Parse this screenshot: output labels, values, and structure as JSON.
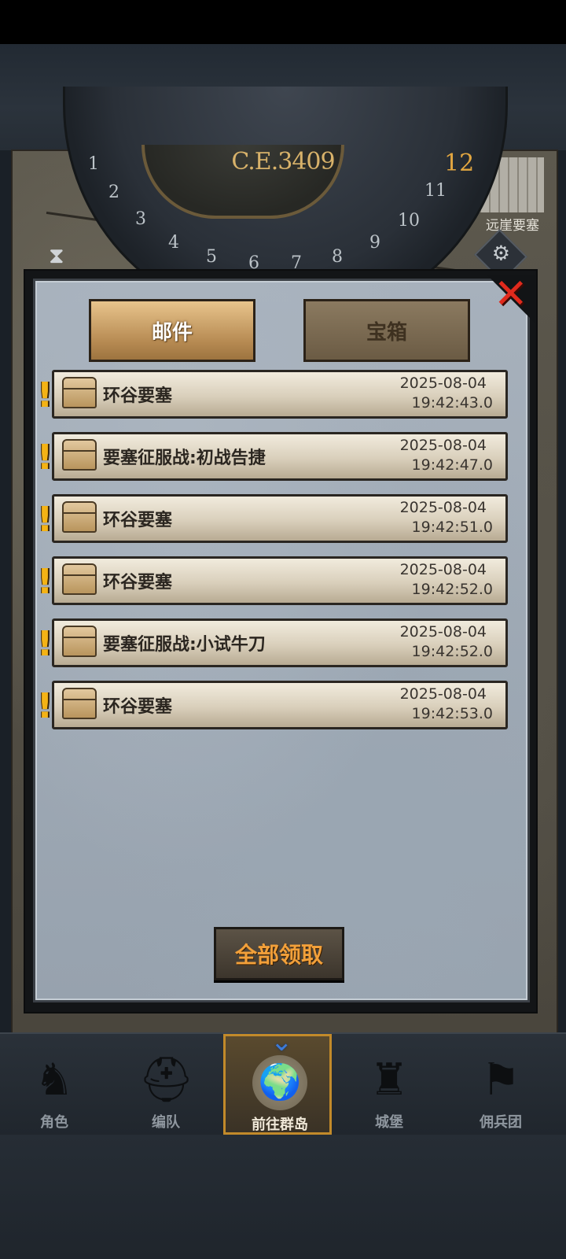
{
  "header": {
    "era": "C.E.3409",
    "hour": "12",
    "dial_numbers": [
      "1",
      "2",
      "3",
      "4",
      "5",
      "6",
      "7",
      "8",
      "9",
      "10",
      "11"
    ],
    "location": "远崖要塞"
  },
  "tabs": [
    {
      "label": "邮件",
      "active": true
    },
    {
      "label": "宝箱",
      "active": false
    }
  ],
  "mails": [
    {
      "title": "环谷要塞",
      "date": "2025-08-04",
      "time": "19:42:43.0",
      "unread": true
    },
    {
      "title": "要塞征服战:初战告捷",
      "date": "2025-08-04",
      "time": "19:42:47.0",
      "unread": true
    },
    {
      "title": "环谷要塞",
      "date": "2025-08-04",
      "time": "19:42:51.0",
      "unread": true
    },
    {
      "title": "环谷要塞",
      "date": "2025-08-04",
      "time": "19:42:52.0",
      "unread": true
    },
    {
      "title": "要塞征服战:小试牛刀",
      "date": "2025-08-04",
      "time": "19:42:52.0",
      "unread": true
    },
    {
      "title": "环谷要塞",
      "date": "2025-08-04",
      "time": "19:42:53.0",
      "unread": true
    }
  ],
  "claim_all_label": "全部领取",
  "close_icon": "close-icon",
  "nav": [
    {
      "label": "角色",
      "icon": "knight-icon",
      "glyph": "♞",
      "active": false
    },
    {
      "label": "编队",
      "icon": "helmet-icon",
      "glyph": "⛑",
      "active": false
    },
    {
      "label": "前往群岛",
      "icon": "globe-icon",
      "glyph": "🌍",
      "active": true
    },
    {
      "label": "城堡",
      "icon": "castle-icon",
      "glyph": "♜",
      "active": false
    },
    {
      "label": "佣兵团",
      "icon": "flag-icon",
      "glyph": "⚑",
      "active": false
    }
  ],
  "colors": {
    "accent_gold": "#c28a2a",
    "claim_text": "#f2a03a",
    "alert": "#f4b315",
    "close": "#e02a1d"
  }
}
